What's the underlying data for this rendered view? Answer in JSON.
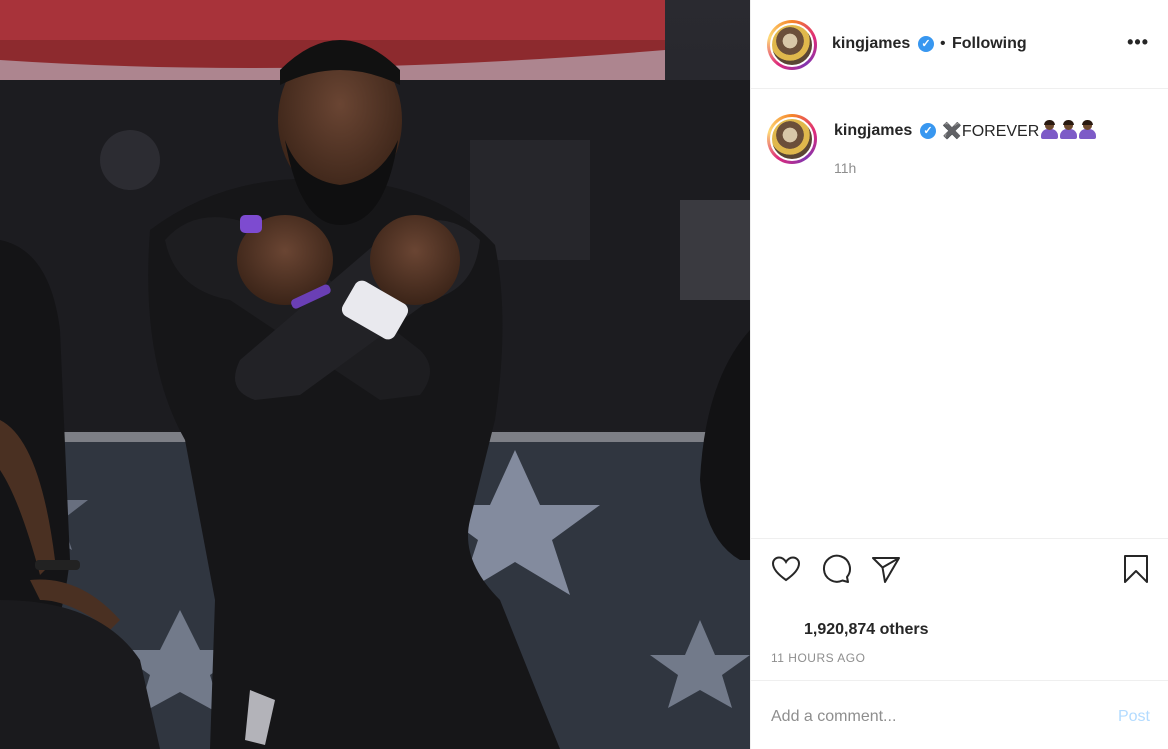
{
  "post": {
    "photo_alt": "Athlete kneeling with arms crossed over chest"
  },
  "header": {
    "username": "kingjames",
    "separator": "•",
    "follow_status": "Following",
    "more_label": "•••"
  },
  "caption": {
    "username": "kingjames",
    "text": "✖️FOREVER",
    "emoji_count": 3,
    "time": "11h"
  },
  "actions": {
    "likes_text": "1,920,874 others",
    "timestamp": "11 HOURS AGO"
  },
  "comment": {
    "placeholder": "Add a comment...",
    "post_label": "Post"
  },
  "colors": {
    "verified": "#3897f0",
    "post_disabled": "#b3dbff",
    "muted": "#8e8e8e",
    "emoji_shirt": "#7d5bc7"
  }
}
